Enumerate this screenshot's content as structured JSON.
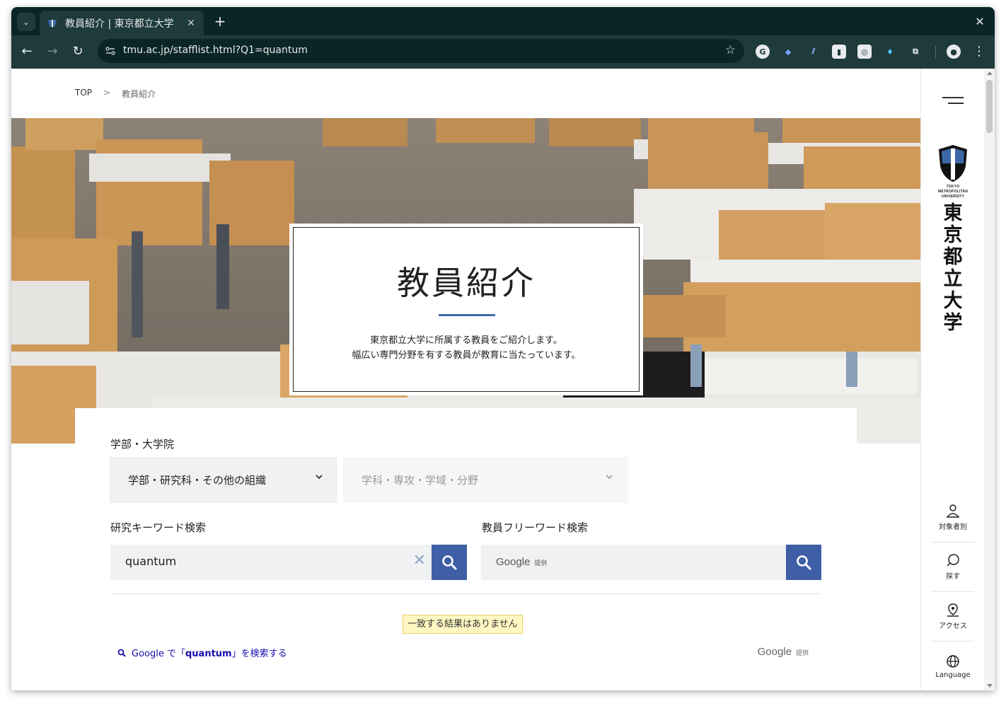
{
  "browser": {
    "tab_title": "教員紹介 | 東京都立大学",
    "tab_close": "✕",
    "new_tab": "+",
    "window_close": "✕",
    "url": "tmu.ac.jp/stafflist.html?Q1=quantum"
  },
  "breadcrumb": {
    "home": "TOP",
    "separator": ">",
    "current": "教員紹介"
  },
  "hero": {
    "title": "教員紹介",
    "description_line1": "東京都立大学に所属する教員をご紹介します。",
    "description_line2": "幅広い専門分野を有する教員が教育に当たっています。"
  },
  "filters": {
    "faculty_label": "学部・大学院",
    "faculty_select": "学部・研究科・その他の組織",
    "department_select": "学科・専攻・学域・分野",
    "keyword_label": "研究キーワード検索",
    "keyword_value": "quantum",
    "freeword_label": "教員フリーワード検索",
    "freeword_google": "Google",
    "freeword_provided": "提供"
  },
  "results": {
    "no_result": "一致する結果はありません",
    "google_search_prefix": "Google で「",
    "google_search_query": "quantum",
    "google_search_suffix": "」を検索する",
    "powered_google": "Google",
    "powered_provided": "提供"
  },
  "sidenav": {
    "logo_en_line1": "TOKYO",
    "logo_en_line2": "METROPOLITAN",
    "logo_en_line3": "UNIVERSITY",
    "logo_jp_1": "東",
    "logo_jp_2": "京",
    "logo_jp_3": "都",
    "logo_jp_4": "立",
    "logo_jp_5": "大",
    "logo_jp_6": "学",
    "items": [
      {
        "label": "対象者別",
        "icon": "person-icon"
      },
      {
        "label": "探す",
        "icon": "search-bubble-icon"
      },
      {
        "label": "アクセス",
        "icon": "map-pin-icon"
      },
      {
        "label": "Language",
        "icon": "globe-icon"
      }
    ]
  },
  "colors": {
    "accent": "#3e5fa5",
    "browser_frame": "#0a2525",
    "browser_toolbar": "#1e3a3a"
  }
}
